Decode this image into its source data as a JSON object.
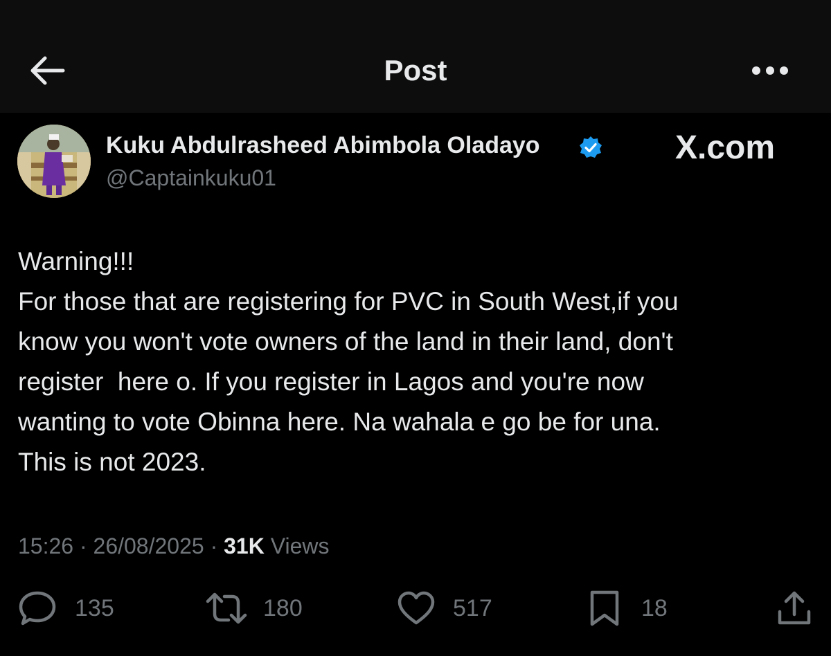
{
  "header": {
    "title": "Post",
    "back_icon": "arrow-left-icon",
    "more_icon": "more-horizontal-icon"
  },
  "author": {
    "name": "Kuku Abdulrasheed Abimbola Oladayo",
    "handle": "@Captainkuku01",
    "verified": true,
    "verified_color": "#1d9bf0"
  },
  "watermark": "X.com",
  "post": {
    "lines": [
      "Warning!!!",
      "For those that are registering for PVC in South West,if you",
      "know you won't vote owners of the land in their land, don't",
      "register  here o. If you register in Lagos and you're now",
      "wanting to vote Obinna here. Na wahala e go be for una.",
      "This is not 2023."
    ]
  },
  "meta": {
    "time": "15:26",
    "separator": " · ",
    "date": "26/08/2025",
    "views_count": "31K",
    "views_label": " Views"
  },
  "actions": {
    "replies": "135",
    "reposts": "180",
    "likes": "517",
    "bookmarks": "18"
  },
  "colors": {
    "background": "#000000",
    "header_background": "#0d0d0d",
    "text_primary": "#e7e9ea",
    "text_secondary": "#71767b"
  }
}
